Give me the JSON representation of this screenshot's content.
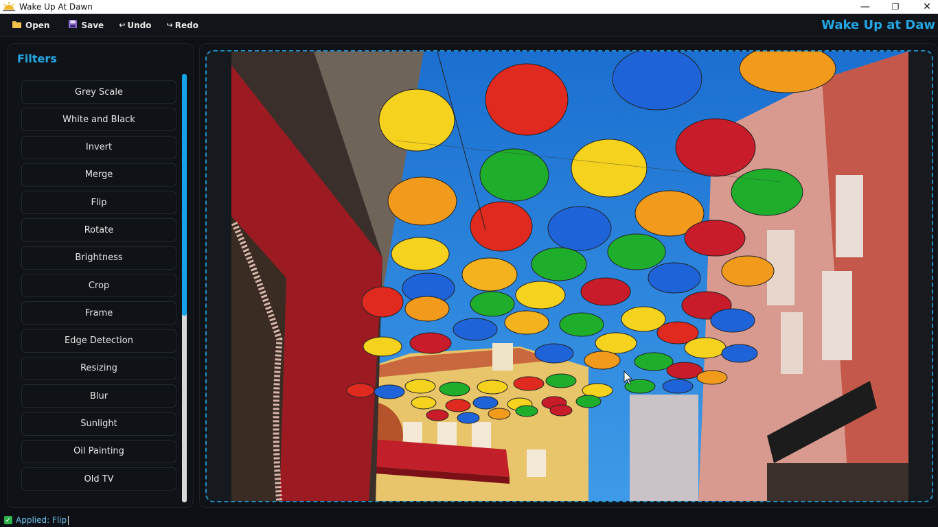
{
  "window": {
    "title": "Wake Up At Dawn",
    "controls": {
      "minimize": "—",
      "maximize": "❐",
      "close": "✕"
    }
  },
  "menubar": {
    "open_label": "Open",
    "save_label": "Save",
    "undo_label": "Undo",
    "redo_label": "Redo",
    "brand": "Wake Up at Daw"
  },
  "sidebar": {
    "title": "Filters",
    "filters": [
      "Grey Scale",
      "White and Black",
      "Invert",
      "Merge",
      "Flip",
      "Rotate",
      "Brightness",
      "Crop",
      "Frame",
      "Edge Detection",
      "Resizing",
      "Blur",
      "Sunlight",
      "Oil Painting",
      "Old TV"
    ]
  },
  "status": {
    "text": "Applied: Flip"
  },
  "colors": {
    "accent": "#25a7e6",
    "background": "#0d1014",
    "panel": "#0f1216",
    "dashed_border": "#1f8fc6",
    "status_ok": "#2bb24c"
  },
  "icons": {
    "open": "folder-icon",
    "save": "floppy-icon",
    "undo": "undo-arrow-icon",
    "redo": "redo-arrow-icon",
    "app": "sunrise-icon",
    "status": "check-icon"
  }
}
